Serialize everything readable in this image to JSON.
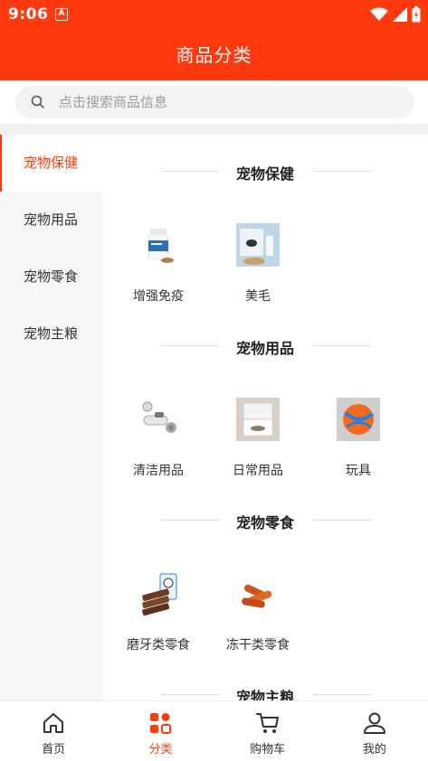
{
  "status_bar": {
    "time": "9:06",
    "notification_glyph": "A"
  },
  "header": {
    "title": "商品分类"
  },
  "search": {
    "placeholder": "点击搜索商品信息"
  },
  "sidebar": {
    "items": [
      {
        "label": "宠物保健",
        "active": true
      },
      {
        "label": "宠物用品",
        "active": false
      },
      {
        "label": "宠物零食",
        "active": false
      },
      {
        "label": "宠物主粮",
        "active": false
      }
    ]
  },
  "sections": [
    {
      "title": "宠物保健",
      "items": [
        {
          "label": "增强免疫",
          "icon": "supplement-jar-icon"
        },
        {
          "label": "美毛",
          "icon": "coat-care-product-icon"
        }
      ]
    },
    {
      "title": "宠物用品",
      "items": [
        {
          "label": "清洁用品",
          "icon": "grooming-brush-icon"
        },
        {
          "label": "日常用品",
          "icon": "pet-feeder-icon"
        },
        {
          "label": "玩具",
          "icon": "ball-toy-icon"
        }
      ]
    },
    {
      "title": "宠物零食",
      "items": [
        {
          "label": "磨牙类零食",
          "icon": "chew-snack-icon"
        },
        {
          "label": "冻干类零食",
          "icon": "freeze-dried-snack-icon"
        }
      ]
    },
    {
      "title": "宠物主粮",
      "items": []
    }
  ],
  "tabbar": {
    "tabs": [
      {
        "label": "首页",
        "icon": "home-icon",
        "active": false
      },
      {
        "label": "分类",
        "icon": "category-icon",
        "active": true
      },
      {
        "label": "购物车",
        "icon": "cart-icon",
        "active": false
      },
      {
        "label": "我的",
        "icon": "profile-icon",
        "active": false
      }
    ]
  },
  "colors": {
    "accent": "#ff3a0f",
    "sidebar_bg": "#f6f6f6",
    "text": "#333333"
  }
}
